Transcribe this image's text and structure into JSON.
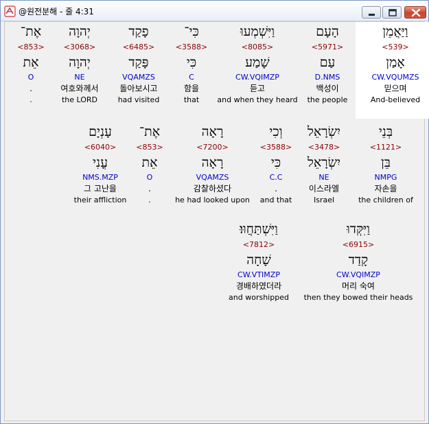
{
  "window": {
    "title": "@원전분해 - 줄 4:31"
  },
  "rows": [
    [
      {
        "heb": "וַיַּאֲמֵן",
        "num": "<539>",
        "lemma": "אָמַן",
        "pos": "CW.VQUMZS",
        "kor": "믿으며",
        "eng": "And-believed",
        "selected": true
      },
      {
        "heb": "הָעָם",
        "num": "<5971>",
        "lemma": "עַם",
        "pos": "D.NMS",
        "kor": "백성이",
        "eng": "the people"
      },
      {
        "heb": "וַיִּשְׁמְעוּ",
        "num": "<8085>",
        "lemma": "שָׁמַע",
        "pos": "CW.VQIMZP",
        "kor": "듣고",
        "eng": "and when they heard"
      },
      {
        "heb": "כִּי־",
        "num": "<3588>",
        "lemma": "כִּי",
        "pos": "C",
        "kor": "함을",
        "eng": "that"
      },
      {
        "heb": "פָקַד",
        "num": "<6485>",
        "lemma": "פָּקַד",
        "pos": "VQAMZS",
        "kor": "돌아보시고",
        "eng": "had visited"
      },
      {
        "heb": "יְהוָה",
        "num": "<3068>",
        "lemma": "יְהוָה",
        "pos": "NE",
        "kor": "여호와께서",
        "eng": "the LORD"
      },
      {
        "heb": "אֶת־",
        "num": "<853>",
        "lemma": "אֵת",
        "pos": "O",
        "kor": ".",
        "eng": "."
      }
    ],
    [
      {
        "heb": "בְּנֵי",
        "num": "<1121>",
        "lemma": "בֵּן",
        "pos": "NMPG",
        "kor": "자손을",
        "eng": "the children of"
      },
      {
        "heb": "יִשְׂרָאֵל",
        "num": "<3478>",
        "lemma": "יִשְׂרָאֵל",
        "pos": "NE",
        "kor": "이스라엘",
        "eng": "Israel"
      },
      {
        "heb": "וְכִי",
        "num": "<3588>",
        "lemma": "כִּי",
        "pos": "C.C",
        "kor": ".",
        "eng": "and that"
      },
      {
        "heb": "רָאָה",
        "num": "<7200>",
        "lemma": "רָאָה",
        "pos": "VQAMZS",
        "kor": "감찰하셨다",
        "eng": "he had looked upon"
      },
      {
        "heb": "אֶת־",
        "num": "<853>",
        "lemma": "אֵת",
        "pos": "O",
        "kor": ".",
        "eng": "."
      },
      {
        "heb": "עָנְיָם",
        "num": "<6040>",
        "lemma": "עֳנִי",
        "pos": "NMS.MZP",
        "kor": "그 고난을",
        "eng": "their affliction"
      }
    ],
    [
      {
        "heb": "וַיִּקְּדוּ",
        "num": "<6915>",
        "lemma": "קָדַד",
        "pos": "CW.VQIMZP",
        "kor": "머리 숙여",
        "eng": "then they bowed their heads"
      },
      {
        "heb": "וַיִּשְׁתַּחֲוּוּ׃",
        "num": "<7812>",
        "lemma": "שָׁחָה",
        "pos": "CW.VTIMZP",
        "kor": "경배하였더라",
        "eng": "and worshipped"
      }
    ]
  ]
}
